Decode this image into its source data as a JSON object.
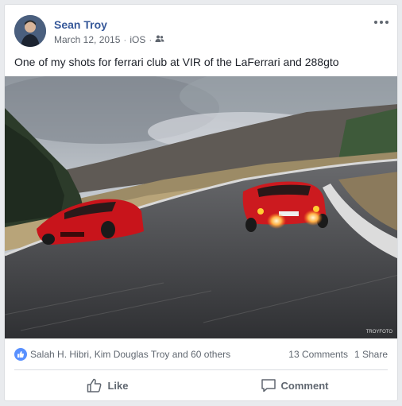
{
  "post": {
    "author": "Sean Troy",
    "date": "March 12, 2015",
    "source": "iOS",
    "separator": "·",
    "audience_icon": "friends-icon",
    "text": "One of my shots for ferrari club at VIR of the LaFerrari and 288gto"
  },
  "photo": {
    "watermark": "TROYFOTO",
    "accent_colors": {
      "car": "#c8141b",
      "flame": "#ffb347",
      "sky": "#c9ced4",
      "asphalt": "#4a4b4f"
    }
  },
  "reactions": {
    "icon": "like-reaction-icon",
    "summary": "Salah H. Hibri, Kim Douglas Troy and 60 others",
    "comments": "13 Comments",
    "shares": "1 Share"
  },
  "actions": {
    "like_label": "Like",
    "comment_label": "Comment"
  },
  "colors": {
    "link": "#365899",
    "like_badge": "#5890ff",
    "muted": "#606770"
  }
}
